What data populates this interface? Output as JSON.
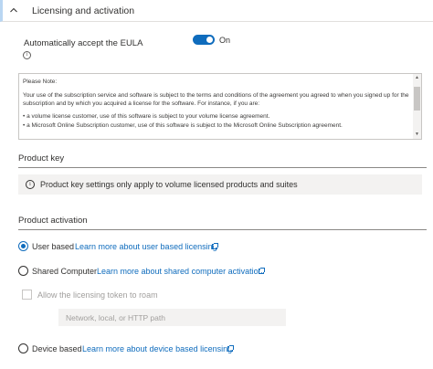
{
  "section": {
    "title": "Licensing and activation"
  },
  "eula": {
    "label": "Automatically accept the EULA",
    "toggle_state": "On",
    "note_heading": "Please Note:",
    "note_lines": [
      "Your use of the subscription service and software is subject to the terms and conditions of the agreement you agreed to when you signed up for the subscription and by which you acquired a license for the software. For instance, if you are:",
      "• a volume license customer, use of this software is subject to your volume license agreement.",
      "• a Microsoft Online Subscription customer, use of this software is subject to the Microsoft Online Subscription agreement."
    ]
  },
  "product_key": {
    "heading": "Product key",
    "banner": "Product key settings only apply to volume licensed products and suites"
  },
  "activation": {
    "heading": "Product activation",
    "options": [
      {
        "label": "User based",
        "link": "Learn more about user based licensing",
        "selected": true
      },
      {
        "label": "Shared Computer",
        "link": "Learn more about shared computer activation",
        "selected": false
      },
      {
        "label": "Device based",
        "link": "Learn more about device based licensing",
        "selected": false
      }
    ],
    "roam_checkbox_label": "Allow the licensing token to roam",
    "path_placeholder": "Network, local, or HTTP path"
  },
  "colors": {
    "accent": "#0f6cbd",
    "banner_bg": "#f3f2f1"
  },
  "icons": [
    "chevron-up-icon",
    "info-icon",
    "external-link-icon"
  ]
}
